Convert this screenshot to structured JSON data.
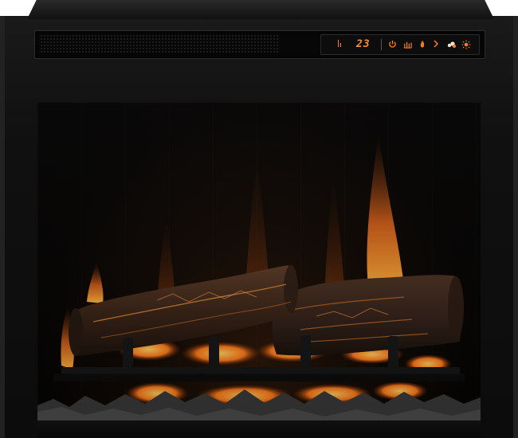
{
  "scene": {
    "subject": "electric-fireplace-insert"
  },
  "control_panel": {
    "temperature_display": "23",
    "buttons": [
      {
        "icon": "power-icon"
      },
      {
        "icon": "flame-effect-icon"
      },
      {
        "icon": "heat-icon"
      },
      {
        "icon": "chevron-right-icon"
      },
      {
        "icon": "ember-icon"
      },
      {
        "icon": "brightness-icon"
      }
    ]
  },
  "colors": {
    "frame": "#0f0f0f",
    "display_glow": "#ff8a30",
    "flame_orange": "#ff7a20",
    "ember_yellow": "#ffc24a",
    "log_brown": "#3b2416"
  }
}
